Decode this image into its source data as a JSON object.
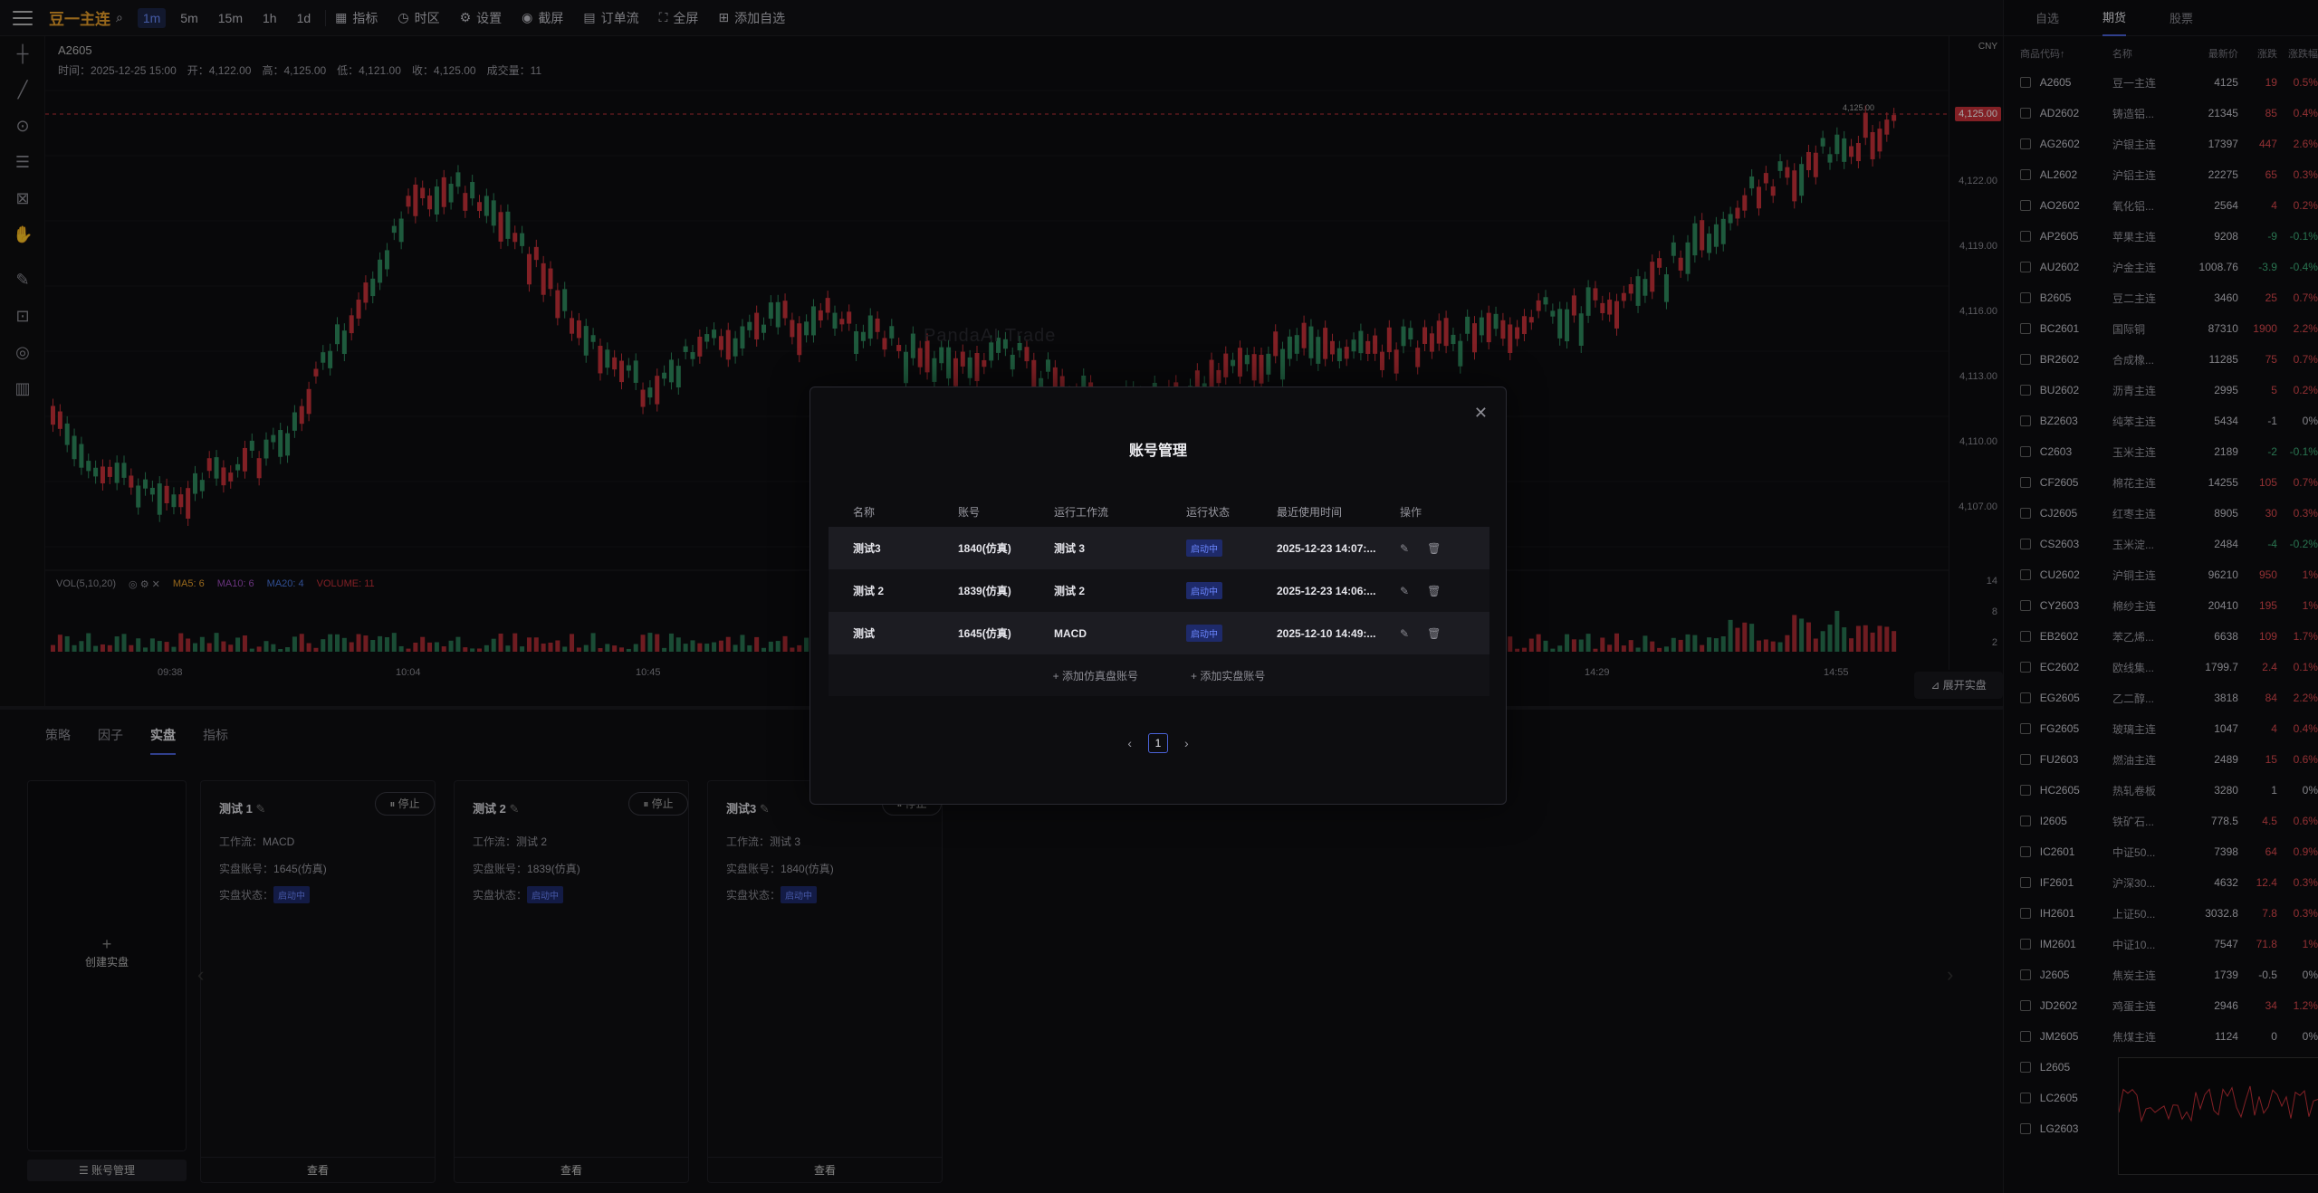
{
  "toolbar": {
    "symbol": "豆一主连",
    "timeframes": [
      "1m",
      "5m",
      "15m",
      "1h",
      "1d"
    ],
    "indicator": "指标",
    "timezone": "时区",
    "settings": "设置",
    "screenshot": "截屏",
    "orderflow": "订单流",
    "fullscreen": "全屏",
    "add_watch": "添加自选"
  },
  "chart": {
    "symbol": "A2605",
    "info": "时间：2025-12-25 15:00　开：4,122.00　高：4,125.00　低：4,121.00　收：4,125.00　成交量：11",
    "currency": "CNY",
    "price_ticks": [
      "4,122.00",
      "4,119.00",
      "4,116.00",
      "4,113.00",
      "4,110.00",
      "4,107.00"
    ],
    "current_price": "4,125.00",
    "marker_price": "4,125.00",
    "vol_ticks": [
      "14",
      "8",
      "2"
    ],
    "vol_label": "VOL(5,10,20)",
    "ma5": "MA5: 6",
    "ma10": "MA10: 6",
    "ma20": "MA20: 4",
    "volume": "VOLUME: 11",
    "time_ticks": [
      "09:38",
      "10:04",
      "10:45",
      "14:29",
      "14:55"
    ],
    "watermark": "PandaAI Trade",
    "expand": "展开实盘"
  },
  "bottom": {
    "tabs": [
      "策略",
      "因子",
      "实盘",
      "指标"
    ],
    "create_label": "创建实盘",
    "acct_mgr": "账号管理",
    "cards": [
      {
        "title": "测试 1",
        "workflow_label": "工作流：",
        "workflow": "MACD",
        "acct_label": "实盘账号：",
        "acct": "1645(仿真)",
        "status_label": "实盘状态：",
        "status": "启动中",
        "stop": "停止",
        "view": "查看"
      },
      {
        "title": "测试 2",
        "workflow_label": "工作流：",
        "workflow": "测试 2",
        "acct_label": "实盘账号：",
        "acct": "1839(仿真)",
        "status_label": "实盘状态：",
        "status": "启动中",
        "stop": "停止",
        "view": "查看"
      },
      {
        "title": "测试3",
        "workflow_label": "工作流：",
        "workflow": "测试 3",
        "acct_label": "实盘账号：",
        "acct": "1840(仿真)",
        "status_label": "实盘状态：",
        "status": "启动中",
        "stop": "停止",
        "view": "查看"
      }
    ]
  },
  "modal": {
    "title": "账号管理",
    "headers": [
      "名称",
      "账号",
      "运行工作流",
      "运行状态",
      "最近使用时间",
      "操作"
    ],
    "rows": [
      {
        "name": "测试3",
        "acct": "1840(仿真)",
        "workflow": "测试 3",
        "status": "启动中",
        "time": "2025-12-23 14:07:..."
      },
      {
        "name": "测试 2",
        "acct": "1839(仿真)",
        "workflow": "测试 2",
        "status": "启动中",
        "time": "2025-12-23 14:06:..."
      },
      {
        "name": "测试",
        "acct": "1645(仿真)",
        "workflow": "MACD",
        "status": "启动中",
        "time": "2025-12-10 14:49:..."
      }
    ],
    "add_sim": "添加仿真盘账号",
    "add_real": "添加实盘账号",
    "page": "1"
  },
  "watch": {
    "tabs": [
      "自选",
      "期货",
      "股票"
    ],
    "headers": [
      "商品代码↑",
      "名称",
      "最新价",
      "涨跌",
      "涨跌幅"
    ],
    "rows": [
      [
        "A2605",
        "豆一主连",
        "4125",
        "19",
        "0.5%",
        "up"
      ],
      [
        "AD2602",
        "铸造铝...",
        "21345",
        "85",
        "0.4%",
        "up"
      ],
      [
        "AG2602",
        "沪银主连",
        "17397",
        "447",
        "2.6%",
        "up"
      ],
      [
        "AL2602",
        "沪铝主连",
        "22275",
        "65",
        "0.3%",
        "up"
      ],
      [
        "AO2602",
        "氧化铝...",
        "2564",
        "4",
        "0.2%",
        "up"
      ],
      [
        "AP2605",
        "苹果主连",
        "9208",
        "-9",
        "-0.1%",
        "down"
      ],
      [
        "AU2602",
        "沪金主连",
        "1008.76",
        "-3.9",
        "-0.4%",
        "down"
      ],
      [
        "B2605",
        "豆二主连",
        "3460",
        "25",
        "0.7%",
        "up"
      ],
      [
        "BC2601",
        "国际铜",
        "87310",
        "1900",
        "2.2%",
        "up"
      ],
      [
        "BR2602",
        "合成橡...",
        "11285",
        "75",
        "0.7%",
        "up"
      ],
      [
        "BU2602",
        "沥青主连",
        "2995",
        "5",
        "0.2%",
        "up"
      ],
      [
        "BZ2603",
        "纯苯主连",
        "5434",
        "-1",
        "0%",
        "flat"
      ],
      [
        "C2603",
        "玉米主连",
        "2189",
        "-2",
        "-0.1%",
        "down"
      ],
      [
        "CF2605",
        "棉花主连",
        "14255",
        "105",
        "0.7%",
        "up"
      ],
      [
        "CJ2605",
        "红枣主连",
        "8905",
        "30",
        "0.3%",
        "up"
      ],
      [
        "CS2603",
        "玉米淀...",
        "2484",
        "-4",
        "-0.2%",
        "down"
      ],
      [
        "CU2602",
        "沪铜主连",
        "96210",
        "950",
        "1%",
        "up"
      ],
      [
        "CY2603",
        "棉纱主连",
        "20410",
        "195",
        "1%",
        "up"
      ],
      [
        "EB2602",
        "苯乙烯...",
        "6638",
        "109",
        "1.7%",
        "up"
      ],
      [
        "EC2602",
        "欧线集...",
        "1799.7",
        "2.4",
        "0.1%",
        "up"
      ],
      [
        "EG2605",
        "乙二醇...",
        "3818",
        "84",
        "2.2%",
        "up"
      ],
      [
        "FG2605",
        "玻璃主连",
        "1047",
        "4",
        "0.4%",
        "up"
      ],
      [
        "FU2603",
        "燃油主连",
        "2489",
        "15",
        "0.6%",
        "up"
      ],
      [
        "HC2605",
        "热轧卷板",
        "3280",
        "1",
        "0%",
        "flat"
      ],
      [
        "I2605",
        "铁矿石...",
        "778.5",
        "4.5",
        "0.6%",
        "up"
      ],
      [
        "IC2601",
        "中证50...",
        "7398",
        "64",
        "0.9%",
        "up"
      ],
      [
        "IF2601",
        "沪深30...",
        "4632",
        "12.4",
        "0.3%",
        "up"
      ],
      [
        "IH2601",
        "上证50...",
        "3032.8",
        "7.8",
        "0.3%",
        "up"
      ],
      [
        "IM2601",
        "中证10...",
        "7547",
        "71.8",
        "1%",
        "up"
      ],
      [
        "J2605",
        "焦炭主连",
        "1739",
        "-0.5",
        "0%",
        "flat"
      ],
      [
        "JD2602",
        "鸡蛋主连",
        "2946",
        "34",
        "1.2%",
        "up"
      ],
      [
        "JM2605",
        "焦煤主连",
        "1124",
        "0",
        "0%",
        "flat"
      ],
      [
        "L2605",
        "",
        "",
        "",
        "",
        ""
      ],
      [
        "LC2605",
        "",
        "",
        "",
        "",
        ""
      ],
      [
        "LG2603",
        "",
        "",
        "",
        "",
        ""
      ]
    ]
  },
  "colors": {
    "up": "#e04a4f",
    "down": "#3fb07a",
    "accent": "#4a62d8"
  }
}
